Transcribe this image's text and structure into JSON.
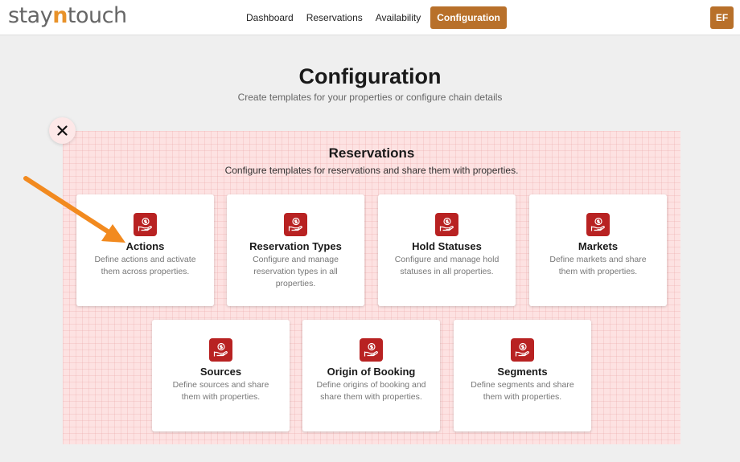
{
  "header": {
    "logo": {
      "pre": "stay",
      "n": "n",
      "post": "touch"
    },
    "nav": [
      "Dashboard",
      "Reservations",
      "Availability",
      "Configuration"
    ],
    "active_nav": "Configuration",
    "avatar": "EF"
  },
  "page": {
    "title": "Configuration",
    "subtitle": "Create templates for your properties or configure chain details"
  },
  "panel": {
    "title": "Reservations",
    "subtitle": "Configure templates for reservations and share them with properties.",
    "cards": [
      {
        "title": "Actions",
        "desc": "Define actions and activate them across properties."
      },
      {
        "title": "Reservation Types",
        "desc": "Configure and manage reservation types in all properties."
      },
      {
        "title": "Hold Statuses",
        "desc": "Configure and manage hold statuses in all properties."
      },
      {
        "title": "Markets",
        "desc": "Define markets and share them with properties."
      },
      {
        "title": "Sources",
        "desc": "Define sources and share them with properties."
      },
      {
        "title": "Origin of Booking",
        "desc": "Define origins of booking and share them with properties."
      },
      {
        "title": "Segments",
        "desc": "Define segments and share them with properties."
      }
    ],
    "card_icon": "hand-coin-icon"
  },
  "colors": {
    "accent": "#b8702a",
    "icon_bg": "#b82222",
    "panel_bg": "#fde2e2",
    "arrow": "#f28a1f"
  }
}
